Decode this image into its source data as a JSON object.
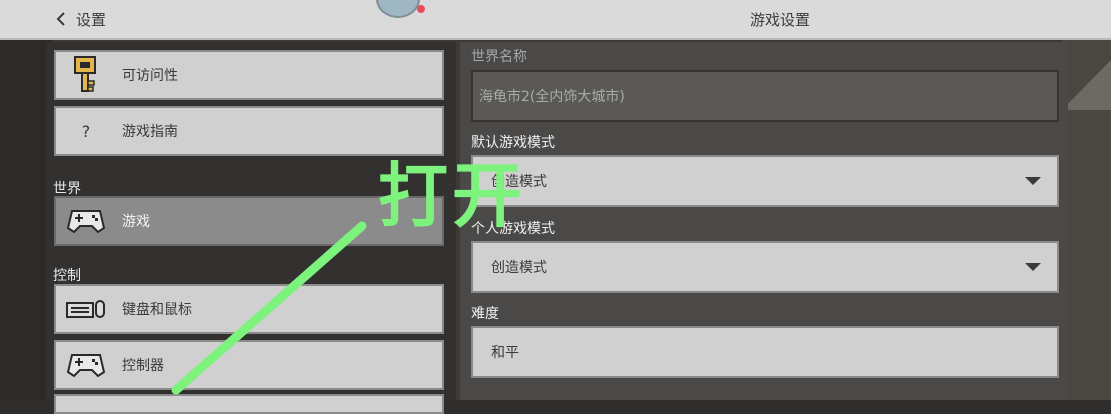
{
  "header": {
    "back_label": "设置",
    "title": "游戏设置"
  },
  "sidebar": {
    "items_top": [
      {
        "label": "可访问性",
        "icon": "key-icon"
      },
      {
        "label": "游戏指南",
        "icon": "help-icon"
      }
    ],
    "section_world": "世界",
    "world_items": [
      {
        "label": "游戏",
        "icon": "gamepad-icon",
        "selected": true
      }
    ],
    "section_controls": "控制",
    "control_items": [
      {
        "label": "键盘和鼠标",
        "icon": "keyboard-mouse-icon"
      },
      {
        "label": "控制器",
        "icon": "gamepad-icon"
      }
    ]
  },
  "form": {
    "world_name_label": "世界名称",
    "world_name_value": "海龟市2(全内饰大城市)",
    "default_mode_label": "默认游戏模式",
    "default_mode_value": "创造模式",
    "personal_mode_label": "个人游戏模式",
    "personal_mode_value": "创造模式",
    "difficulty_label": "难度",
    "difficulty_value": "和平"
  },
  "annotation": {
    "text": "打开",
    "color": "#7df27c"
  },
  "colors": {
    "button": "#d0d0d0",
    "selected": "#8b8b8b",
    "topbar": "#dadada"
  }
}
